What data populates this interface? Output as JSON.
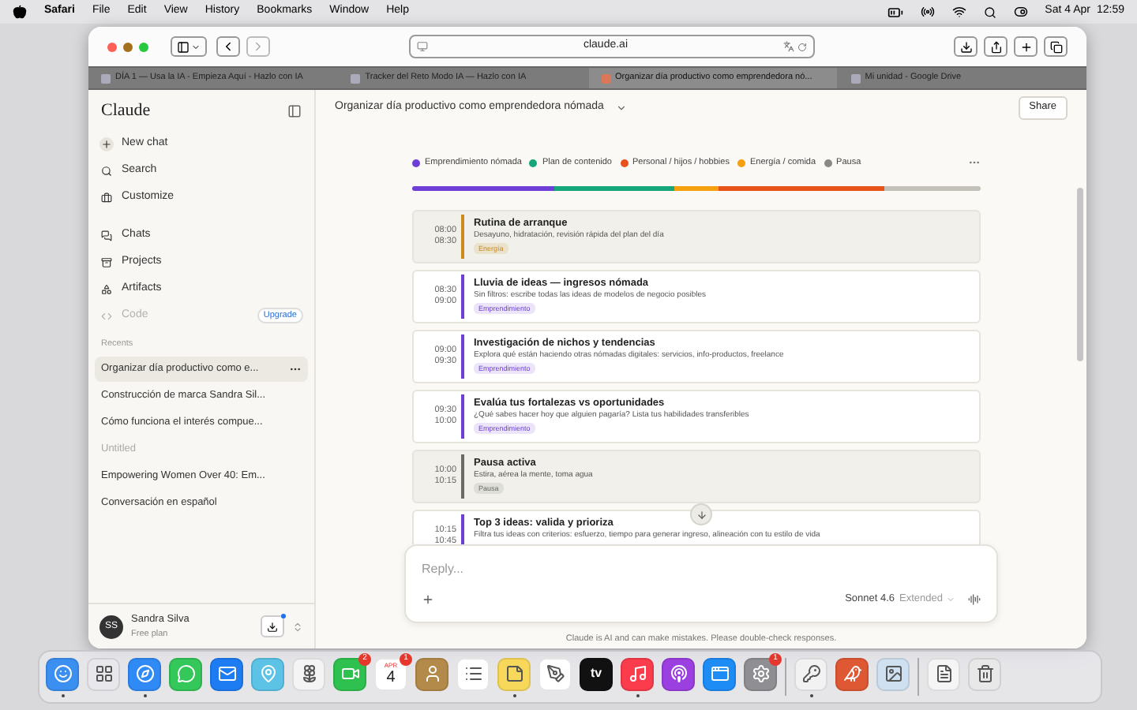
{
  "menu_bar": {
    "app": "Safari",
    "menus": [
      "File",
      "Edit",
      "View",
      "History",
      "Bookmarks",
      "Window",
      "Help"
    ],
    "date": "Sat 4 Apr",
    "time": "12:59"
  },
  "browser": {
    "url": "claude.ai",
    "tabs": [
      {
        "title": "DÍA 1 — Usa la IA - Empieza Aquí - Hazlo con IA",
        "selected": false
      },
      {
        "title": "Tracker del Reto Modo IA — Hazlo con IA",
        "selected": false
      },
      {
        "title": "Organizar día productivo como emprendedora nó...",
        "selected": true
      },
      {
        "title": "Mi unidad - Google Drive",
        "selected": false
      }
    ]
  },
  "sidebar": {
    "brand": "Claude",
    "actions": [
      {
        "kind": "new",
        "label": "New chat"
      },
      {
        "kind": "search",
        "label": "Search"
      },
      {
        "kind": "customize",
        "label": "Customize"
      }
    ],
    "nav": [
      {
        "kind": "chats",
        "label": "Chats",
        "disabled": false
      },
      {
        "kind": "projects",
        "label": "Projects",
        "disabled": false
      },
      {
        "kind": "artifacts",
        "label": "Artifacts",
        "disabled": false
      },
      {
        "kind": "code",
        "label": "Code",
        "disabled": true,
        "badge": "Upgrade"
      }
    ],
    "recents_label": "Recents",
    "recents": [
      {
        "title": "Organizar día productivo como e...",
        "selected": true,
        "dimmed": false
      },
      {
        "title": "Construcción de marca Sandra Sil...",
        "selected": false,
        "dimmed": false
      },
      {
        "title": "Cómo funciona el interés compue...",
        "selected": false,
        "dimmed": false
      },
      {
        "title": "Untitled",
        "selected": false,
        "dimmed": true
      },
      {
        "title": "Empowering Women Over 40: Em...",
        "selected": false,
        "dimmed": false
      },
      {
        "title": "Conversación en español",
        "selected": false,
        "dimmed": false
      }
    ],
    "user": {
      "initials": "SS",
      "name": "Sandra Silva",
      "plan": "Free plan"
    }
  },
  "chat": {
    "title": "Organizar día productivo como emprendedora nómada",
    "share": "Share",
    "legend": [
      {
        "label": "Emprendimiento nómada",
        "color": "#6d3fd6"
      },
      {
        "label": "Plan de contenido",
        "color": "#17a57a"
      },
      {
        "label": "Personal / hijos / hobbies",
        "color": "#e8531b"
      },
      {
        "label": "Energía / comida",
        "color": "#f5a00f"
      },
      {
        "label": "Pausa",
        "color": "#8a8a84"
      }
    ],
    "day_bar": [
      {
        "color": "#6d3fd6"
      },
      {
        "color": "#17a57a"
      },
      {
        "color": "#f5a00f"
      },
      {
        "color": "#e8531b"
      },
      {
        "color": "#c2c0b8"
      }
    ],
    "blocks": [
      {
        "kind": "break",
        "start": "08:00",
        "end": "08:30",
        "title": "Rutina de arranque",
        "description": "Desayuno, hidratación, revisión rápida del plan del día",
        "tag": "Energía",
        "color": "#c98a1e"
      },
      {
        "kind": "task",
        "start": "08:30",
        "end": "09:00",
        "title": "Lluvia de ideas — ingresos nómada",
        "description": "Sin filtros: escribe todas las ideas de modelos de negocio posibles",
        "tag": "Emprendimiento",
        "color": "#6d3fd6"
      },
      {
        "kind": "task",
        "start": "09:00",
        "end": "09:30",
        "title": "Investigación de nichos y tendencias",
        "description": "Explora qué están haciendo otras nómadas digitales: servicios, info-productos, freelance",
        "tag": "Emprendimiento",
        "color": "#6d3fd6"
      },
      {
        "kind": "task",
        "start": "09:30",
        "end": "10:00",
        "title": "Evalúa tus fortalezas vs oportunidades",
        "description": "¿Qué sabes hacer hoy que alguien pagaría? Lista tus habilidades transferibles",
        "tag": "Emprendimiento",
        "color": "#6d3fd6"
      },
      {
        "kind": "break",
        "start": "10:00",
        "end": "10:15",
        "title": "Pausa activa",
        "description": "Estira, aérea la mente, toma agua",
        "tag": "Pausa",
        "color": "#6b6b66"
      },
      {
        "kind": "task",
        "start": "10:15",
        "end": "10:45",
        "title": "Top 3 ideas: valida y prioriza",
        "description": "Filtra tus ideas con criterios: esfuerzo, tiempo para generar ingreso, alineación con tu estilo de vida",
        "color": "#6d3fd6"
      }
    ],
    "composer": {
      "placeholder": "Reply...",
      "model": "Sonnet 4.6",
      "mode": "Extended"
    },
    "disclaimer": "Claude is AI and can make mistakes. Please double-check responses."
  },
  "dock": [
    {
      "kind": "finder",
      "color": "#3b8ff0",
      "running": true
    },
    {
      "kind": "launchpad",
      "color": "#e8e8ec",
      "running": false
    },
    {
      "kind": "safari",
      "color": "#2f8af5",
      "running": true
    },
    {
      "kind": "messages",
      "color": "#34c759",
      "running": false
    },
    {
      "kind": "mail",
      "color": "#1e7cf2",
      "running": false
    },
    {
      "kind": "maps",
      "color": "#5cc2e6",
      "running": false
    },
    {
      "kind": "photos",
      "color": "#f4f4f4",
      "running": false
    },
    {
      "kind": "facetime",
      "color": "#2fc14f",
      "running": false,
      "badge": "2"
    },
    {
      "kind": "calendar",
      "color": "#ffffff",
      "running": false,
      "badge": "1",
      "month": "APR",
      "day": "4"
    },
    {
      "kind": "contacts",
      "color": "#b48a4a",
      "running": false
    },
    {
      "kind": "reminders",
      "color": "#ffffff",
      "running": false
    },
    {
      "kind": "notes",
      "color": "#f7d85a",
      "running": true
    },
    {
      "kind": "freeform",
      "color": "#ffffff",
      "running": false
    },
    {
      "kind": "tv",
      "color": "#111111",
      "running": false,
      "label": "tv"
    },
    {
      "kind": "music",
      "color": "#fa3c4c",
      "running": true
    },
    {
      "kind": "podcasts",
      "color": "#9b3fe0",
      "running": false
    },
    {
      "kind": "appstore",
      "color": "#1d8cf5",
      "running": false
    },
    {
      "kind": "settings",
      "color": "#8e8e93",
      "running": false,
      "badge": "1"
    },
    {
      "kind": "separator"
    },
    {
      "kind": "passwords",
      "color": "#f2f2f2",
      "running": true
    },
    {
      "kind": "duckduckgo",
      "color": "#de5833",
      "running": false
    },
    {
      "kind": "preview",
      "color": "#cfe0f0",
      "running": false
    },
    {
      "kind": "separator"
    },
    {
      "kind": "document",
      "color": "#f5f5f5",
      "running": false
    },
    {
      "kind": "trash",
      "color": "#e8e8e8",
      "running": false
    }
  ]
}
